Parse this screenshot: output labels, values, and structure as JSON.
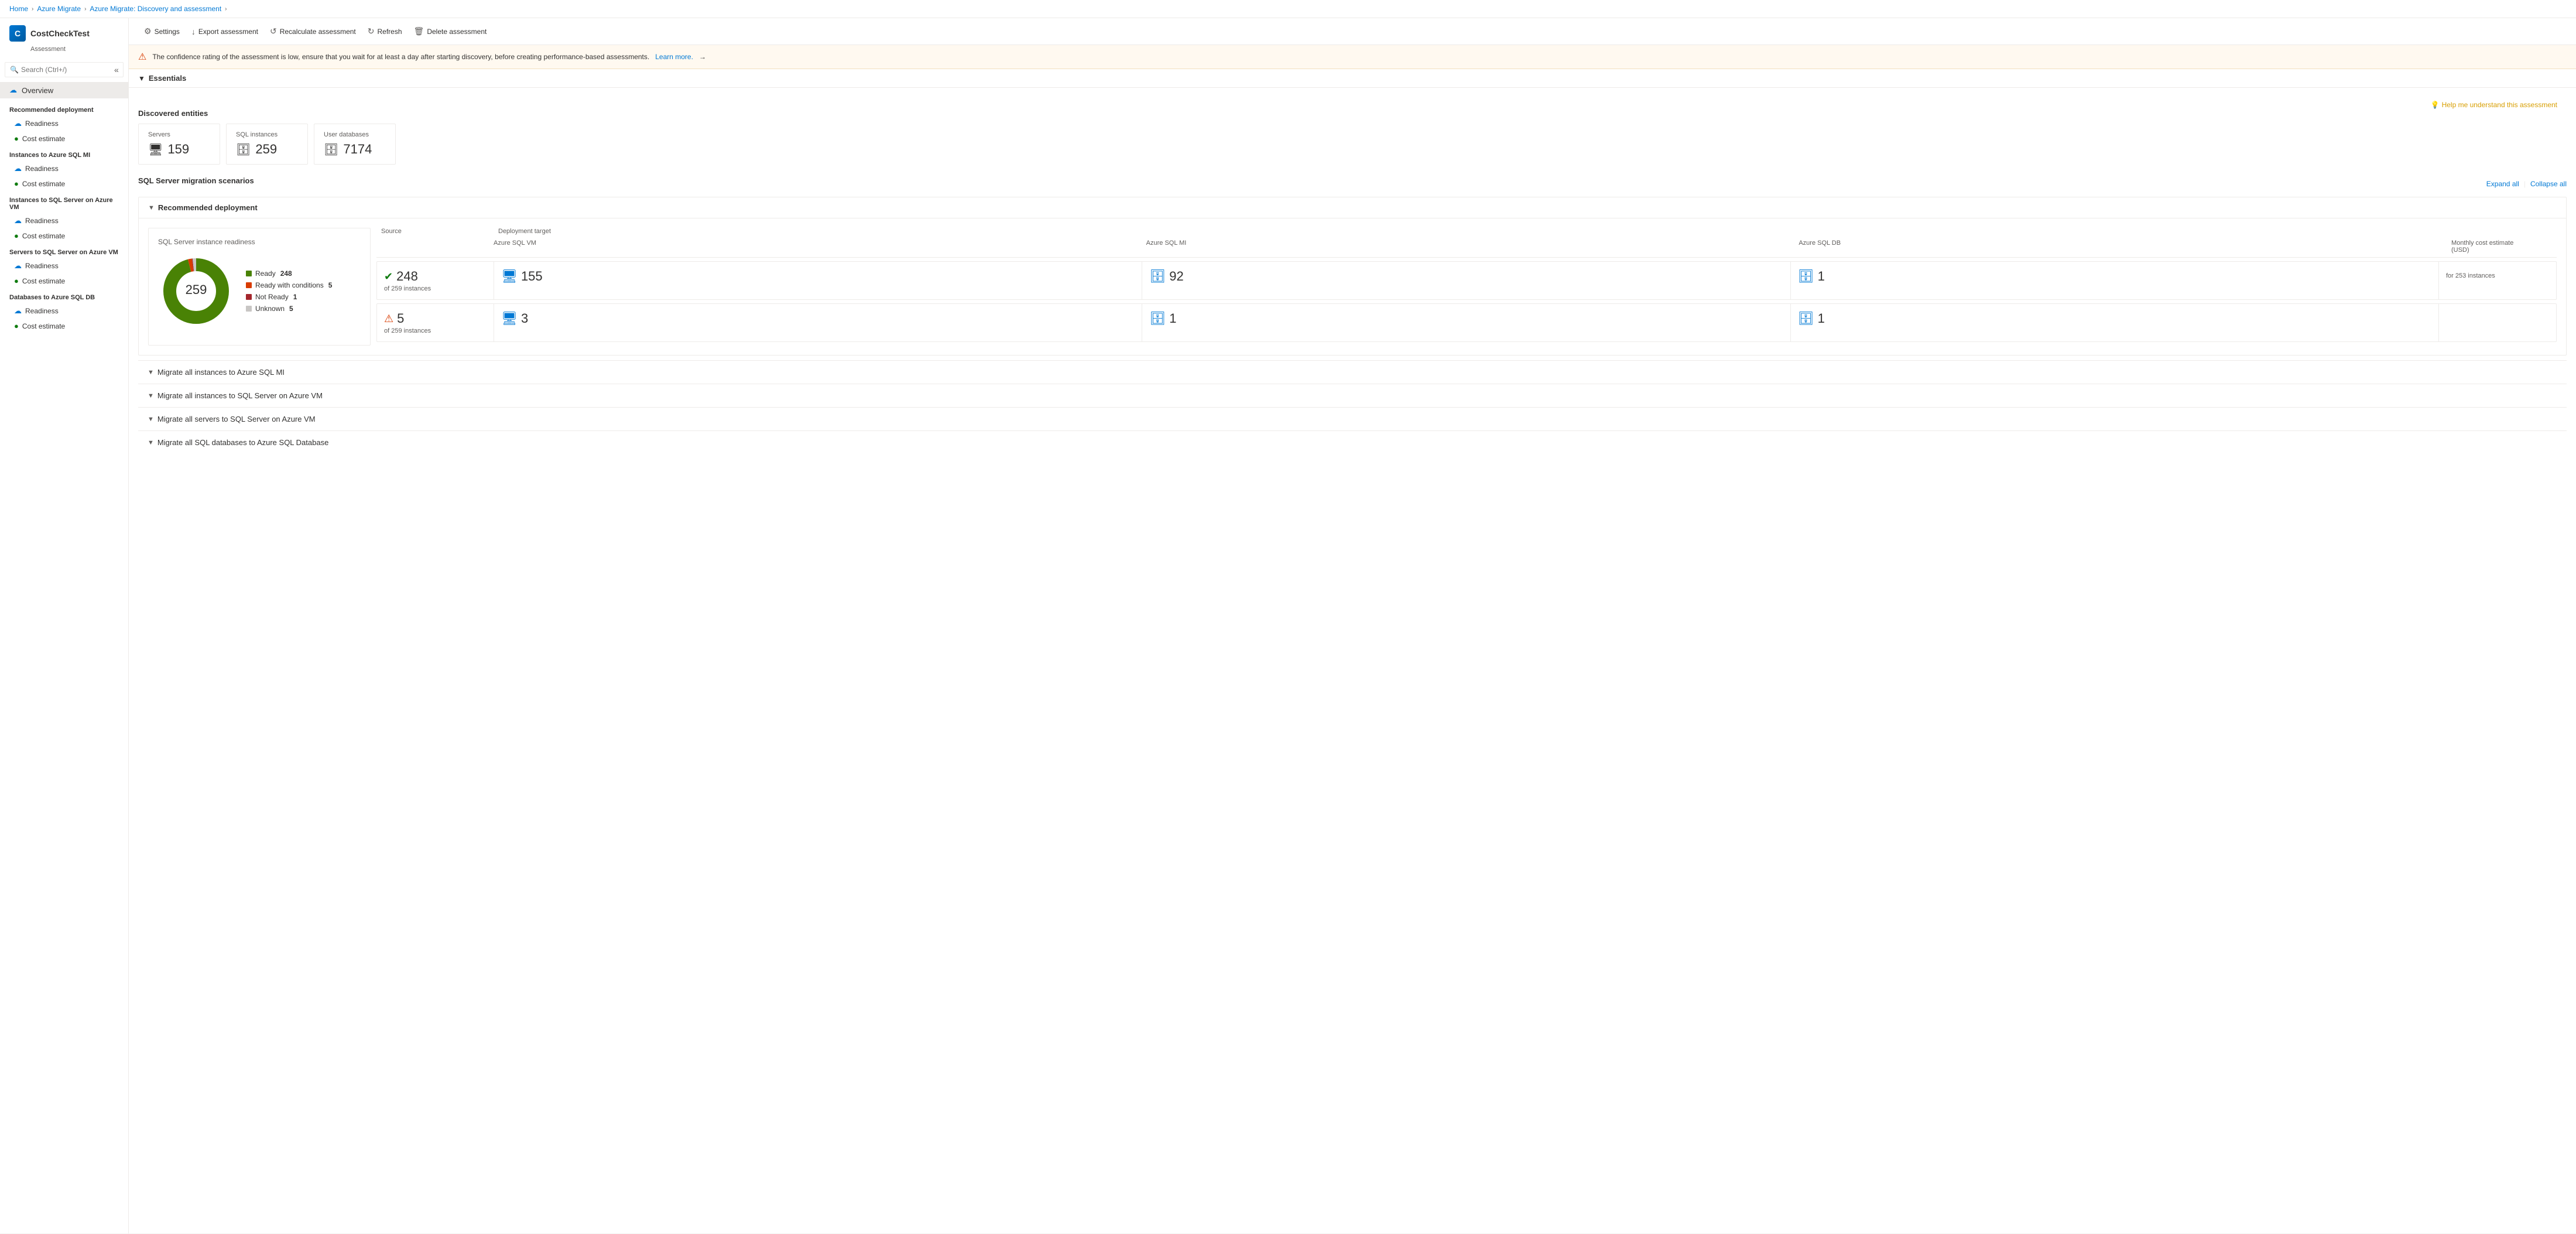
{
  "breadcrumb": {
    "items": [
      "Home",
      "Azure Migrate",
      "Azure Migrate: Discovery and assessment"
    ]
  },
  "sidebar": {
    "logo_text": "C",
    "title": "CostCheckTest",
    "subtitle": "Assessment",
    "search_placeholder": "Search (Ctrl+/)",
    "collapse_icon": "«",
    "overview_label": "Overview",
    "sections": [
      {
        "label": "Recommended deployment",
        "items": [
          {
            "icon": "cloud",
            "text": "Readiness"
          },
          {
            "icon": "green",
            "text": "Cost estimate"
          }
        ]
      },
      {
        "label": "Instances to Azure SQL MI",
        "items": [
          {
            "icon": "cloud",
            "text": "Readiness"
          },
          {
            "icon": "green",
            "text": "Cost estimate"
          }
        ]
      },
      {
        "label": "Instances to SQL Server on Azure VM",
        "items": [
          {
            "icon": "cloud",
            "text": "Readiness"
          },
          {
            "icon": "green",
            "text": "Cost estimate"
          }
        ]
      },
      {
        "label": "Servers to SQL Server on Azure VM",
        "items": [
          {
            "icon": "cloud",
            "text": "Readiness"
          },
          {
            "icon": "green",
            "text": "Cost estimate"
          }
        ]
      },
      {
        "label": "Databases to Azure SQL DB",
        "items": [
          {
            "icon": "cloud",
            "text": "Readiness"
          },
          {
            "icon": "green",
            "text": "Cost estimate"
          }
        ]
      }
    ]
  },
  "toolbar": {
    "buttons": [
      {
        "icon": "⚙",
        "label": "Settings"
      },
      {
        "icon": "↓",
        "label": "Export assessment"
      },
      {
        "icon": "↺",
        "label": "Recalculate assessment"
      },
      {
        "icon": "↻",
        "label": "Refresh"
      },
      {
        "icon": "🗑",
        "label": "Delete assessment"
      }
    ]
  },
  "warning": {
    "text": "The confidence rating of the assessment is low, ensure that you wait for at least a day after starting discovery, before creating performance-based assessments.",
    "link_text": "Learn more.",
    "arrow": "→"
  },
  "essentials": {
    "label": "Essentials",
    "collapsed": false
  },
  "discovered_entities": {
    "title": "Discovered entities",
    "cards": [
      {
        "label": "Servers",
        "value": "159",
        "icon": "🖥"
      },
      {
        "label": "SQL instances",
        "value": "259",
        "icon": "🗄"
      },
      {
        "label": "User databases",
        "value": "7174",
        "icon": "🗄"
      }
    ]
  },
  "migration_scenarios": {
    "title": "SQL Server migration scenarios",
    "expand_label": "Expand all",
    "collapse_label": "Collapse all",
    "recommended_label": "Recommended deployment",
    "chart": {
      "title": "SQL Server instance readiness",
      "center_label": "259",
      "legend": [
        {
          "color": "#498205",
          "label": "Ready",
          "count": "248"
        },
        {
          "color": "#d83b01",
          "label": "Ready with conditions",
          "count": "5"
        },
        {
          "color": "#a4262c",
          "label": "Not Ready",
          "count": "1"
        },
        {
          "color": "#c8c6c4",
          "label": "Unknown",
          "count": "5"
        }
      ],
      "donut_segments": [
        {
          "color": "#498205",
          "value": 248
        },
        {
          "color": "#d83b01",
          "value": 5
        },
        {
          "color": "#a4262c",
          "value": 1
        },
        {
          "color": "#c8c6c4",
          "value": 5
        }
      ]
    },
    "stats_headers": {
      "source": "Source",
      "deployment_target": "Deployment target",
      "azure_sql_vm": "Azure SQL VM",
      "azure_sql_mi": "Azure SQL MI",
      "azure_sql_db": "Azure SQL DB",
      "monthly_cost": "Monthly cost estimate\n(USD)"
    },
    "rows": [
      {
        "status": "ready",
        "instances": "248",
        "instances_sub": "of 259 instances",
        "azure_sql_vm": "155",
        "azure_sql_mi": "92",
        "azure_sql_db": "1",
        "cost": "",
        "cost_sub": "for 253 instances"
      },
      {
        "status": "warning",
        "instances": "5",
        "instances_sub": "of 259 instances",
        "azure_sql_vm": "3",
        "azure_sql_mi": "1",
        "azure_sql_db": "1",
        "cost": "",
        "cost_sub": ""
      }
    ],
    "collapse_items": [
      "Migrate all instances to Azure SQL MI",
      "Migrate all instances to SQL Server on Azure VM",
      "Migrate all servers to SQL Server on Azure VM",
      "Migrate all SQL databases to Azure SQL Database"
    ]
  },
  "help": {
    "icon": "💡",
    "label": "Help me understand this assessment"
  }
}
